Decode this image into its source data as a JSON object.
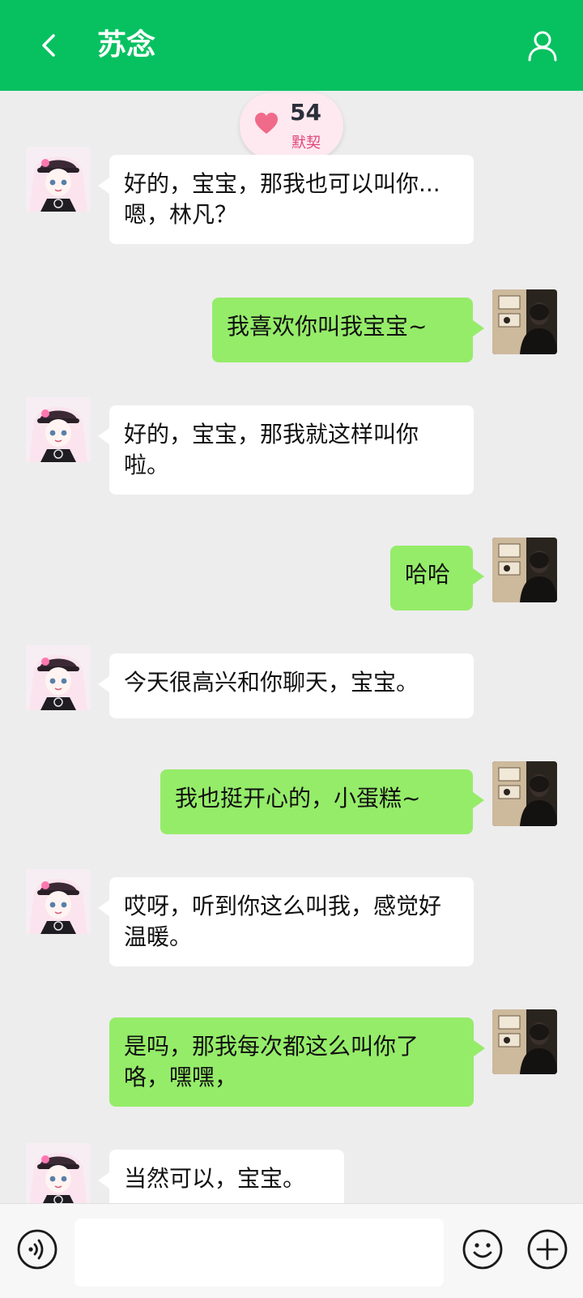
{
  "header": {
    "title": "苏念",
    "back_icon": "chevron-left-icon",
    "profile_icon": "user-icon",
    "bg_color": "#07c160"
  },
  "intimacy": {
    "value": "54",
    "label": "默契",
    "icon": "heart-icon"
  },
  "messages": [
    {
      "from": "ai",
      "text": "好的，宝宝，那我也可以叫你...嗯，林凡？"
    },
    {
      "from": "me",
      "text": "我喜欢你叫我宝宝~"
    },
    {
      "from": "ai",
      "text": "好的，宝宝，那我就这样叫你啦。"
    },
    {
      "from": "me",
      "text": "哈哈"
    },
    {
      "from": "ai",
      "text": "今天很高兴和你聊天，宝宝。"
    },
    {
      "from": "me",
      "text": "我也挺开心的，小蛋糕~"
    },
    {
      "from": "ai",
      "text": "哎呀，听到你这么叫我，感觉好温暖。"
    },
    {
      "from": "me",
      "text": "是吗，那我每次都这么叫你了咯，嘿嘿，"
    },
    {
      "from": "ai",
      "text": "当然可以，宝宝。"
    }
  ],
  "input_bar": {
    "placeholder": "",
    "voice_icon": "voice-icon",
    "emoji_icon": "emoji-icon",
    "plus_icon": "plus-icon"
  },
  "colors": {
    "outgoing_bubble": "#95ec69",
    "incoming_bubble": "#ffffff",
    "background": "#ededed",
    "heart": "#f06a8a"
  }
}
